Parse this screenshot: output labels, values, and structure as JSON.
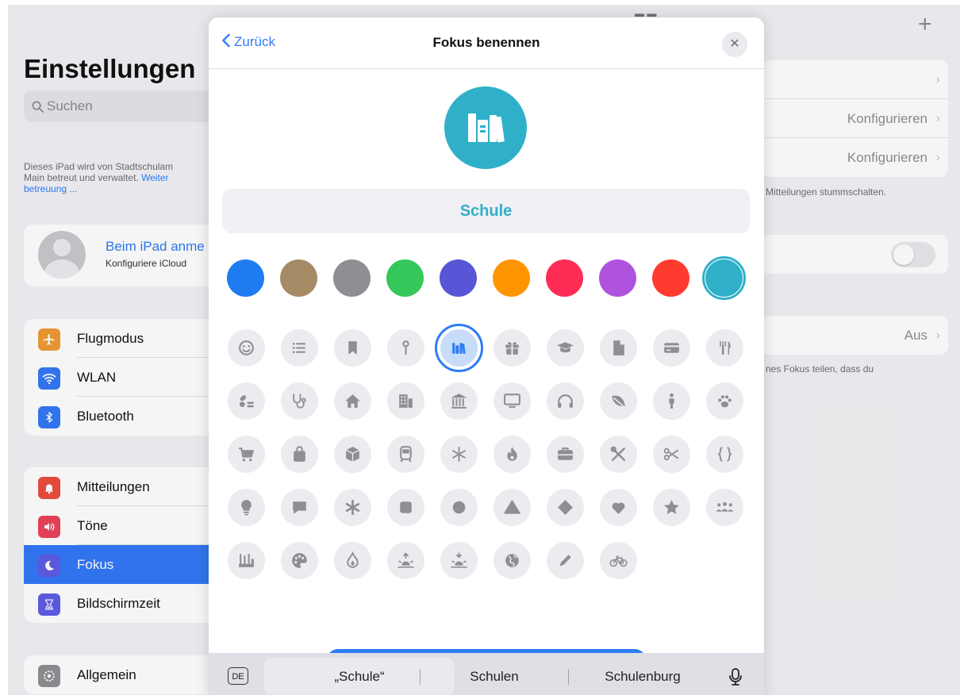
{
  "settings": {
    "title": "Einstellungen",
    "search_placeholder": "Suchen",
    "managed_line1": "Dieses iPad wird von Stadtschulam",
    "managed_line2_prefix": "Main betreut und verwaltet. ",
    "managed_link1": "Weiter",
    "managed_link2": "betreuung ...",
    "profile": {
      "name": "Beim iPad anme",
      "subtitle": "Konfiguriere iCloud"
    },
    "group1": [
      {
        "label": "Flugmodus",
        "icon": "airplane-icon",
        "color": "#f09a37"
      },
      {
        "label": "WLAN",
        "icon": "wifi-icon",
        "color": "#3478f6"
      },
      {
        "label": "Bluetooth",
        "icon": "bluetooth-icon",
        "color": "#3478f6"
      }
    ],
    "group2": [
      {
        "label": "Mitteilungen",
        "icon": "bell-icon",
        "color": "#eb4d3d"
      },
      {
        "label": "Töne",
        "icon": "speaker-icon",
        "color": "#eb445a"
      },
      {
        "label": "Fokus",
        "icon": "moon-icon",
        "color": "#5e5ce6",
        "active": true
      },
      {
        "label": "Bildschirmzeit",
        "icon": "hourglass-icon",
        "color": "#5e5ce6"
      }
    ],
    "group3": [
      {
        "label": "Allgemein",
        "icon": "gear-icon",
        "color": "#8e8e93"
      }
    ]
  },
  "detail": {
    "rows1": [
      {
        "value": ""
      },
      {
        "value": "Konfigurieren"
      },
      {
        "value": "Konfigurieren"
      }
    ],
    "note1": "Mitteilungen stummschalten.",
    "row_aus": "Aus",
    "note2": "nes Fokus teilen, dass du"
  },
  "sheet": {
    "back_label": "Zurück",
    "title": "Fokus benennen",
    "focus_name": "Schule",
    "preview_icon": "books-icon",
    "accent": "#2fb0c8",
    "colors": [
      "#1f7cf0",
      "#a58a66",
      "#8e8e93",
      "#35c759",
      "#5856d6",
      "#ff9500",
      "#ff2d55",
      "#af52de",
      "#ff3b30",
      "#2fb0c8"
    ],
    "selected_color_index": 9,
    "glyph_rows": [
      [
        "smiley-icon",
        "list-icon",
        "bookmark-icon",
        "pin-icon",
        "books-icon",
        "gift-icon",
        "graduation-cap-icon",
        "document-icon",
        "credit-card-icon",
        "fork-knife-icon"
      ],
      [
        "pills-icon",
        "stethoscope-icon",
        "house-icon",
        "building-icon",
        "bank-icon",
        "desktop-icon",
        "headphones-icon",
        "leaf-icon",
        "person-icon",
        "paw-icon"
      ],
      [
        "cart-icon",
        "shopping-bag-icon",
        "cube-icon",
        "tram-icon",
        "snowflake-icon",
        "flame-icon",
        "briefcase-icon",
        "wrench-screwdriver-icon",
        "scissors-icon",
        "curly-braces-icon"
      ],
      [
        "lightbulb-icon",
        "speech-bubble-icon",
        "asterisk-icon",
        "square-icon",
        "circle-icon",
        "triangle-icon",
        "diamond-icon",
        "heart-icon",
        "star-icon",
        "people-icon"
      ],
      [
        "factory-icon",
        "palette-icon",
        "drop-flame-icon",
        "sunrise-icon",
        "sunset-icon",
        "globe-icon",
        "pencil-icon",
        "bicycle-icon"
      ]
    ],
    "selected_glyph": "books-icon"
  },
  "keyboard": {
    "lang": "DE",
    "suggestions": [
      "„Schule“",
      "Schulen",
      "Schulenburg"
    ],
    "mic_icon": "microphone-icon"
  }
}
